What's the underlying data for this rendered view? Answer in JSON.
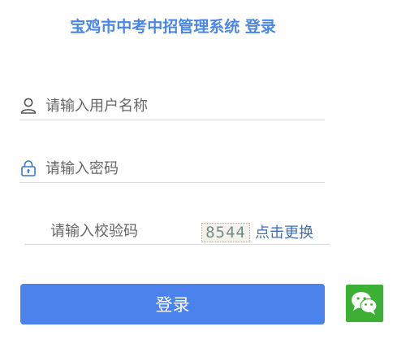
{
  "header": {
    "title": "宝鸡市中考中招管理系统 登录"
  },
  "form": {
    "username_placeholder": "请输入用户名称",
    "password_placeholder": "请输入密码",
    "captcha_placeholder": "请输入校验码",
    "captcha_image_text": "8544",
    "captcha_refresh_label": "点击更换",
    "login_button_label": "登录"
  },
  "icons": {
    "username": "user-icon",
    "password": "lock-icon",
    "wechat": "wechat-icon"
  },
  "colors": {
    "accent": "#4c82ec",
    "title": "#4a86e8",
    "link": "#3e6fb6",
    "wechat": "#3cb034"
  }
}
